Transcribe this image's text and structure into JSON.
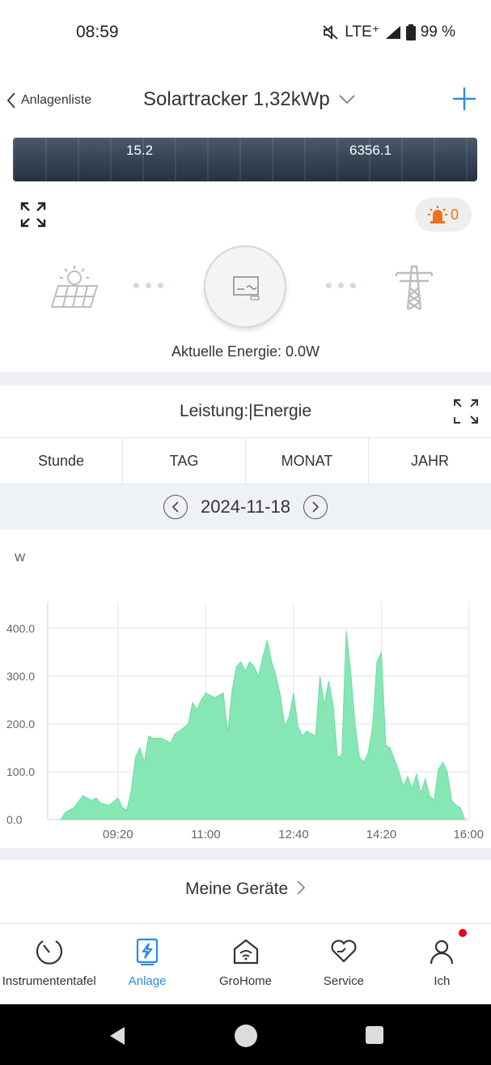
{
  "status_bar": {
    "time": "08:59",
    "network": "LTE⁺",
    "battery": "99 %"
  },
  "header": {
    "back_label": "Anlagenliste",
    "title": "Solartracker 1,32kWp"
  },
  "banner": {
    "value_left": "15.2",
    "value_right": "6356.1"
  },
  "alarm": {
    "count": "0"
  },
  "flow": {
    "current_energy": "Aktuelle Energie: 0.0W"
  },
  "chart_header": {
    "title": "Leistung:|Energie"
  },
  "tabs": [
    {
      "label": "Stunde",
      "active": true
    },
    {
      "label": "TAG",
      "active": false
    },
    {
      "label": "MONAT",
      "active": false
    },
    {
      "label": "JAHR",
      "active": false
    }
  ],
  "date": "2024-11-18",
  "chart_data": {
    "type": "area",
    "ylabel": "W",
    "ylim": [
      0,
      420
    ],
    "yticks": [
      "0.0",
      "100.0",
      "200.0",
      "300.0",
      "400.0"
    ],
    "xticks": [
      "09:20",
      "11:00",
      "12:40",
      "14:20",
      "16:00"
    ],
    "xlim_minutes": [
      480,
      960
    ],
    "color": "#86e6b4",
    "x_minutes": [
      495,
      500,
      510,
      520,
      525,
      530,
      535,
      540,
      550,
      560,
      565,
      570,
      575,
      580,
      585,
      590,
      595,
      600,
      610,
      620,
      625,
      630,
      640,
      645,
      650,
      655,
      660,
      665,
      670,
      675,
      680,
      685,
      690,
      695,
      700,
      705,
      710,
      715,
      720,
      725,
      730,
      735,
      740,
      745,
      750,
      755,
      760,
      765,
      770,
      775,
      780,
      785,
      790,
      795,
      800,
      805,
      810,
      815,
      820,
      825,
      830,
      835,
      840,
      845,
      850,
      855,
      860,
      865,
      870,
      875,
      880,
      885,
      890,
      895,
      900,
      905,
      910,
      915,
      920,
      925,
      930,
      935,
      940,
      945,
      950,
      955
    ],
    "values": [
      0,
      15,
      25,
      50,
      45,
      40,
      45,
      35,
      30,
      45,
      25,
      20,
      60,
      130,
      150,
      120,
      175,
      170,
      170,
      160,
      180,
      185,
      200,
      245,
      230,
      250,
      265,
      260,
      255,
      260,
      265,
      180,
      270,
      320,
      330,
      310,
      330,
      320,
      300,
      340,
      375,
      330,
      300,
      260,
      195,
      215,
      265,
      195,
      175,
      185,
      180,
      175,
      300,
      240,
      290,
      240,
      130,
      135,
      395,
      310,
      200,
      130,
      120,
      140,
      195,
      330,
      350,
      155,
      150,
      125,
      100,
      70,
      90,
      65,
      95,
      55,
      85,
      50,
      40,
      105,
      120,
      100,
      40,
      30,
      25,
      0
    ]
  },
  "devices": {
    "label": "Meine Geräte"
  },
  "bottom_nav": [
    {
      "label": "Instrumententafel",
      "icon": "gauge-icon"
    },
    {
      "label": "Anlage",
      "icon": "lightning-icon"
    },
    {
      "label": "GroHome",
      "icon": "home-wifi-icon"
    },
    {
      "label": "Service",
      "icon": "heart-icon"
    },
    {
      "label": "Ich",
      "icon": "person-icon"
    }
  ]
}
